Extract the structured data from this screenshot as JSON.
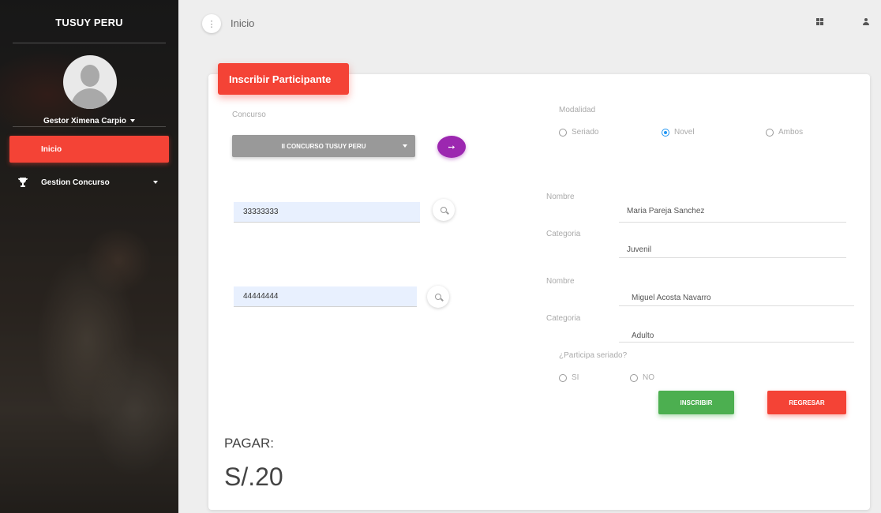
{
  "sidebar": {
    "brand": "TUSUY PERU",
    "user_name": "Gestor Ximena Carpio",
    "items": [
      {
        "label": "Inicio",
        "icon": "dashboard-icon",
        "active": true
      },
      {
        "label": "Gestion Concurso",
        "icon": "trophy-icon",
        "active": false
      }
    ]
  },
  "header": {
    "title": "Inicio",
    "menu_glyph": "⋮"
  },
  "card": {
    "title": "Inscribir Participante",
    "concurso_label": "Concurso",
    "concurso_selected": "II CONCURSO TUSUY PERU",
    "go_glyph": "➙",
    "modalidad_label": "Modalidad",
    "modalidad_options": [
      "Seriado",
      "Novel",
      "Ambos"
    ],
    "modalidad_selected": "Novel",
    "participant1": {
      "dni": "33333333",
      "nombre_label": "Nombre",
      "nombre": "Maria Pareja Sanchez",
      "categoria_label": "Categoria",
      "categoria": "Juvenil"
    },
    "participant2": {
      "dni": "44444444",
      "nombre_label": "Nombre",
      "nombre": "Miguel Acosta Navarro",
      "categoria_label": "Categoria",
      "categoria": "Adulto"
    },
    "seriado_question": "¿Participa seriado?",
    "seriado_options": [
      "SI",
      "NO"
    ],
    "inscribir_label": "INSCRIBIR",
    "regresar_label": "REGRESAR",
    "pagar_label": "PAGAR:",
    "pagar_value": "S/.20"
  },
  "colors": {
    "accent_red": "#f44336",
    "accent_purple": "#9c27b0",
    "accent_green": "#4caf50",
    "radio_blue": "#2196f3"
  }
}
